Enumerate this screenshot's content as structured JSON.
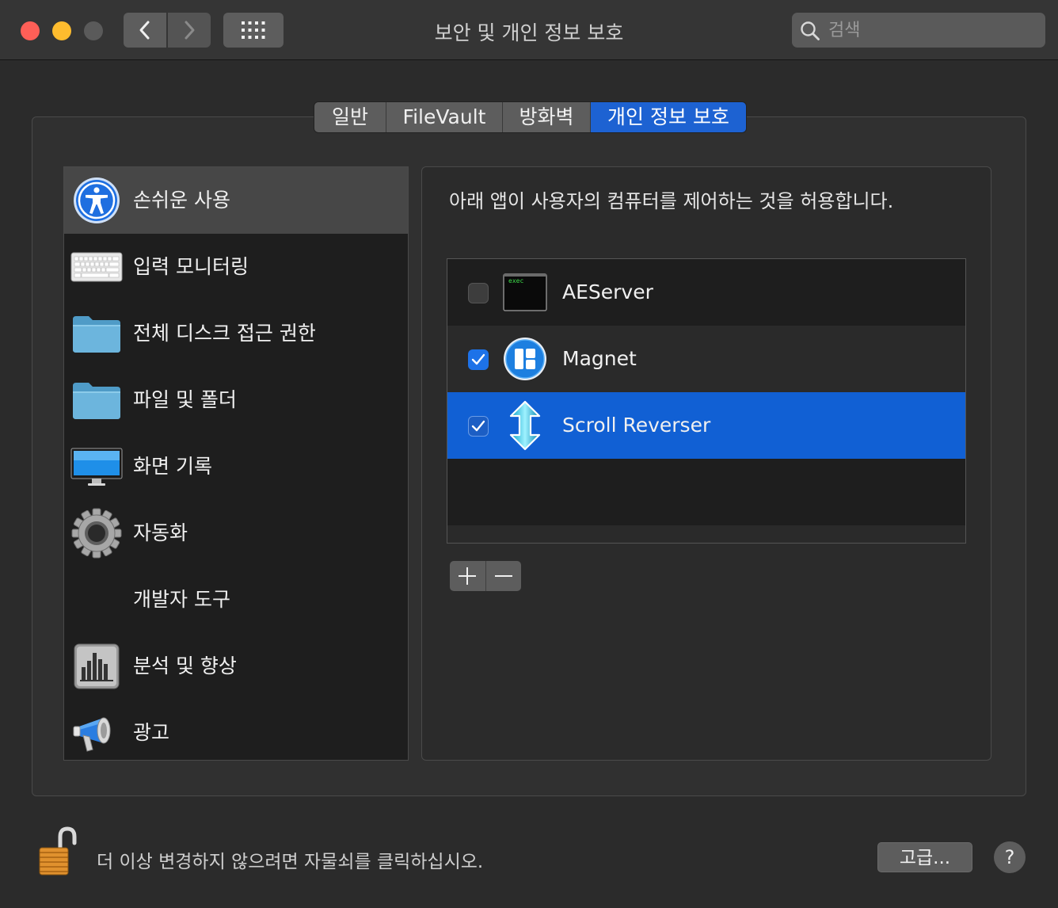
{
  "window": {
    "title": "보안 및 개인 정보 보호",
    "search_placeholder": "검색"
  },
  "tabs": [
    {
      "label": "일반",
      "active": false
    },
    {
      "label": "FileVault",
      "active": false
    },
    {
      "label": "방화벽",
      "active": false
    },
    {
      "label": "개인 정보 보호",
      "active": true
    }
  ],
  "sidebar": {
    "items": [
      {
        "label": "손쉬운 사용",
        "icon": "accessibility-icon",
        "selected": true
      },
      {
        "label": "입력 모니터링",
        "icon": "keyboard-icon"
      },
      {
        "label": "전체 디스크 접근 권한",
        "icon": "folder-icon"
      },
      {
        "label": "파일 및 폴더",
        "icon": "folder-icon"
      },
      {
        "label": "화면 기록",
        "icon": "display-icon"
      },
      {
        "label": "자동화",
        "icon": "gear-icon"
      },
      {
        "label": "개발자 도구",
        "icon": ""
      },
      {
        "label": "분석 및 향상",
        "icon": "chart-icon"
      },
      {
        "label": "광고",
        "icon": "megaphone-icon"
      }
    ]
  },
  "panel": {
    "description": "아래 앱이 사용자의 컴퓨터를 제어하는 것을 허용합니다.",
    "apps": [
      {
        "name": "AEServer",
        "checked": false,
        "icon": "terminal-exec-icon",
        "icon_text": "exec"
      },
      {
        "name": "Magnet",
        "checked": true,
        "icon": "magnet-app-icon"
      },
      {
        "name": "Scroll Reverser",
        "checked": true,
        "icon": "scroll-reverser-icon",
        "selected": true
      }
    ],
    "add_label": "+",
    "remove_label": "−"
  },
  "footer": {
    "lock_text": "더 이상 변경하지 않으려면 자물쇠를 클릭하십시오.",
    "advanced_label": "고급...",
    "help_label": "?"
  },
  "colors": {
    "accent": "#1d62d2",
    "selected_row": "#1160d4",
    "close": "#fe5f57",
    "minimize": "#febc2e"
  }
}
